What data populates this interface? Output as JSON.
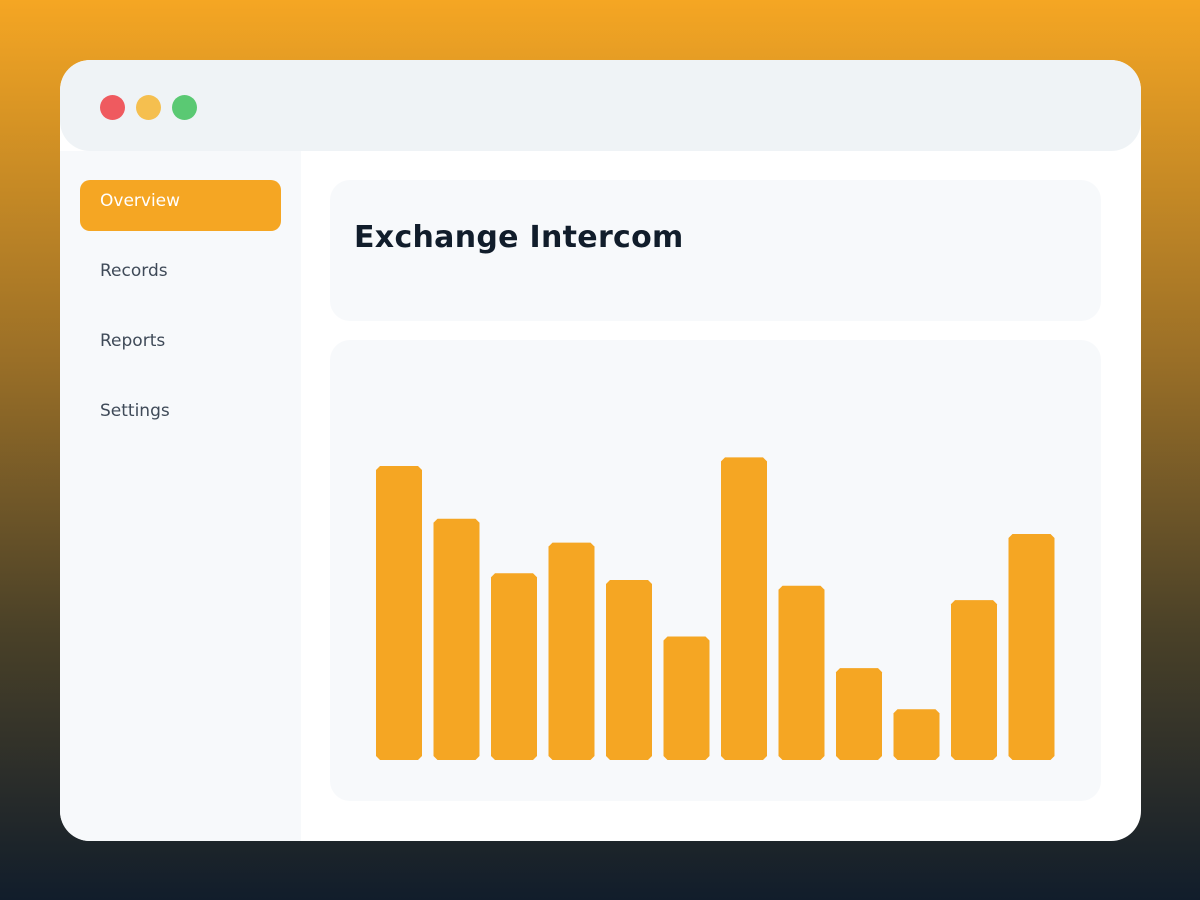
{
  "window": {
    "controls": [
      {
        "name": "close-dot",
        "color": "#EF5A5F"
      },
      {
        "name": "minimize-dot",
        "color": "#F5BF4F"
      },
      {
        "name": "maximize-dot",
        "color": "#5AC973"
      }
    ]
  },
  "sidebar": {
    "items": [
      {
        "label": "Overview",
        "active": true
      },
      {
        "label": "Records",
        "active": false
      },
      {
        "label": "Reports",
        "active": false
      },
      {
        "label": "Settings",
        "active": false
      }
    ]
  },
  "main": {
    "title": "Exchange Intercom"
  },
  "colors": {
    "accent": "#F5A623",
    "title_text": "#111D2B",
    "nav_text": "#3F4A58"
  },
  "chart_data": {
    "type": "bar",
    "values": [
      307,
      252,
      195,
      227,
      188,
      129,
      316,
      182,
      96,
      53,
      167,
      236
    ],
    "ylim": [
      0,
      330
    ],
    "grid": false,
    "color": "#F5A623"
  }
}
